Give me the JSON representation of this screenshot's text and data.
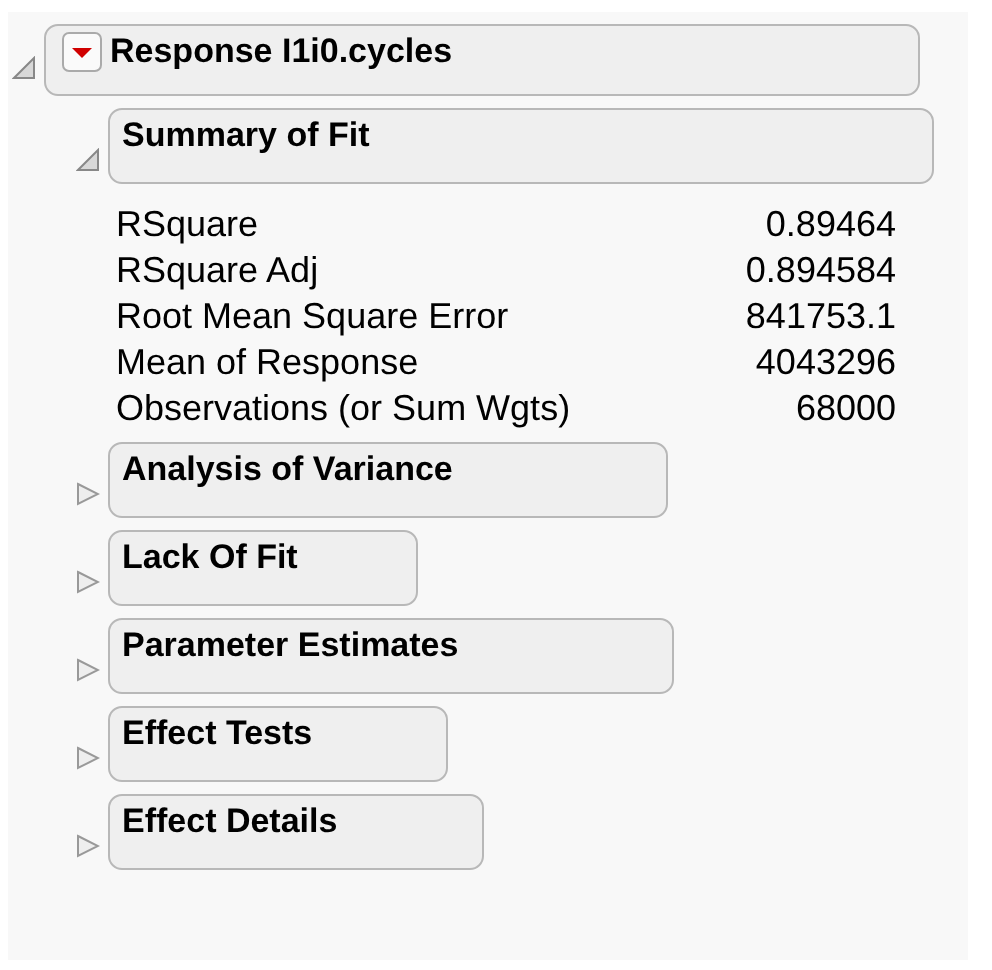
{
  "report": {
    "title": "Response I1i0.cycles",
    "expanded": true,
    "sections": [
      {
        "title": "Summary of Fit",
        "expanded": true,
        "rows": [
          {
            "label": "RSquare",
            "value": "0.89464"
          },
          {
            "label": "RSquare Adj",
            "value": "0.894584"
          },
          {
            "label": "Root Mean Square Error",
            "value": "841753.1"
          },
          {
            "label": "Mean of Response",
            "value": "4043296"
          },
          {
            "label": "Observations (or Sum Wgts)",
            "value": "68000"
          }
        ]
      },
      {
        "title": "Analysis of Variance",
        "expanded": false
      },
      {
        "title": "Lack Of Fit",
        "expanded": false
      },
      {
        "title": "Parameter Estimates",
        "expanded": false
      },
      {
        "title": "Effect Tests",
        "expanded": false
      },
      {
        "title": "Effect Details",
        "expanded": false
      }
    ]
  }
}
